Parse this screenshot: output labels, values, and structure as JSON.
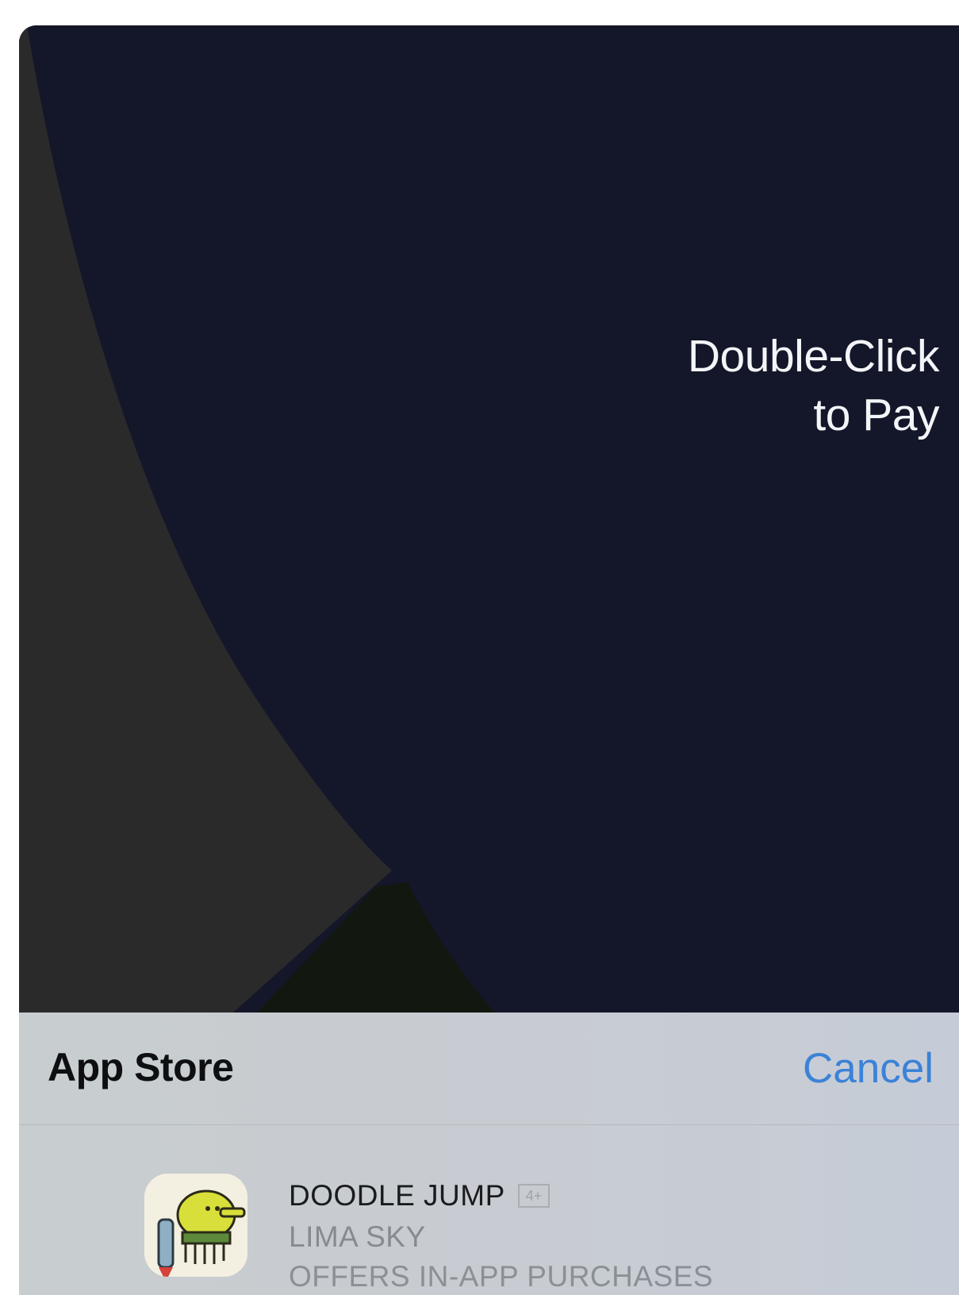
{
  "lock_screen": {
    "pay_prompt_line1": "Double-Click",
    "pay_prompt_line2": "to Pay"
  },
  "payment_sheet": {
    "title": "App Store",
    "cancel_label": "Cancel",
    "app": {
      "name": "DOODLE JUMP",
      "age_rating": "4+",
      "developer": "LIMA SKY",
      "note": "OFFERS IN-APP PURCHASES"
    }
  },
  "colors": {
    "wallpaper_dark": "#141729",
    "wallpaper_grey": "#2a2a2b",
    "sheet_background": "#c8cdcf",
    "accent_blue": "#3b82d7"
  }
}
